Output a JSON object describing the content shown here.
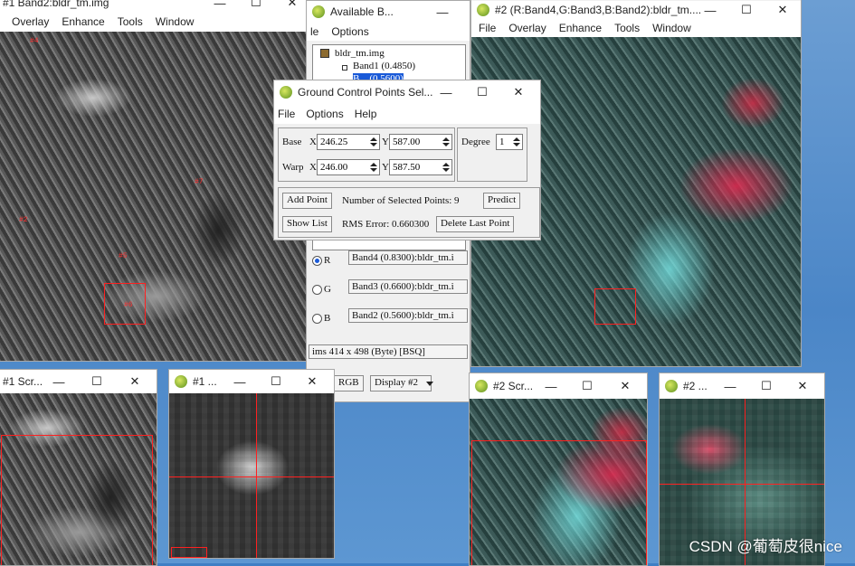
{
  "main_gray": {
    "title": "#1 Band2:bldr_tm.img",
    "menu": [
      "Overlay",
      "Enhance",
      "Tools",
      "Window"
    ],
    "gcp_labels": [
      "#4",
      "#7",
      "#2",
      "#5",
      "#6"
    ]
  },
  "band_list": {
    "title": "Available B...",
    "menu": [
      "le",
      "Options"
    ],
    "file": "bldr_tm.img",
    "bands": [
      "Band1 (0.4850)",
      "B...  (0.5600)"
    ],
    "rgb": [
      {
        "channel": "R",
        "band": "Band4 (0.8300):bldr_tm.i",
        "selected": true
      },
      {
        "channel": "G",
        "band": "Band3 (0.6600):bldr_tm.i",
        "selected": false
      },
      {
        "channel": "B",
        "band": "Band2 (0.5600):bldr_tm.i",
        "selected": false
      }
    ],
    "dims": "ims 414 x 498 (Byte) [BSQ]",
    "rgb_button": "RGB",
    "display_button": "Display #2"
  },
  "main_color": {
    "title": "#2 (R:Band4,G:Band3,B:Band2):bldr_tm....",
    "menu": [
      "File",
      "Overlay",
      "Enhance",
      "Tools",
      "Window"
    ]
  },
  "gcp_dialog": {
    "title": "Ground Control Points Sel...",
    "menu": [
      "File",
      "Options",
      "Help"
    ],
    "base_label": "Base",
    "warp_label": "Warp",
    "x_label": "X",
    "y_label": "Y",
    "base_x": "246.25",
    "base_y": "587.00",
    "warp_x": "246.00",
    "warp_y": "587.50",
    "degree_label": "Degree",
    "degree_value": "1",
    "add_point": "Add Point",
    "selected_points": "Number of Selected Points: 9",
    "predict": "Predict",
    "show_list": "Show List",
    "rms_error": "RMS Error: 0.660300",
    "delete_last": "Delete Last Point"
  },
  "scroll1": {
    "title": "#1 Scr..."
  },
  "zoom1": {
    "title": "#1 ..."
  },
  "scroll2": {
    "title": "#2 Scr..."
  },
  "zoom2": {
    "title": "#2 ..."
  },
  "watermark": "CSDN @葡萄皮很nice"
}
